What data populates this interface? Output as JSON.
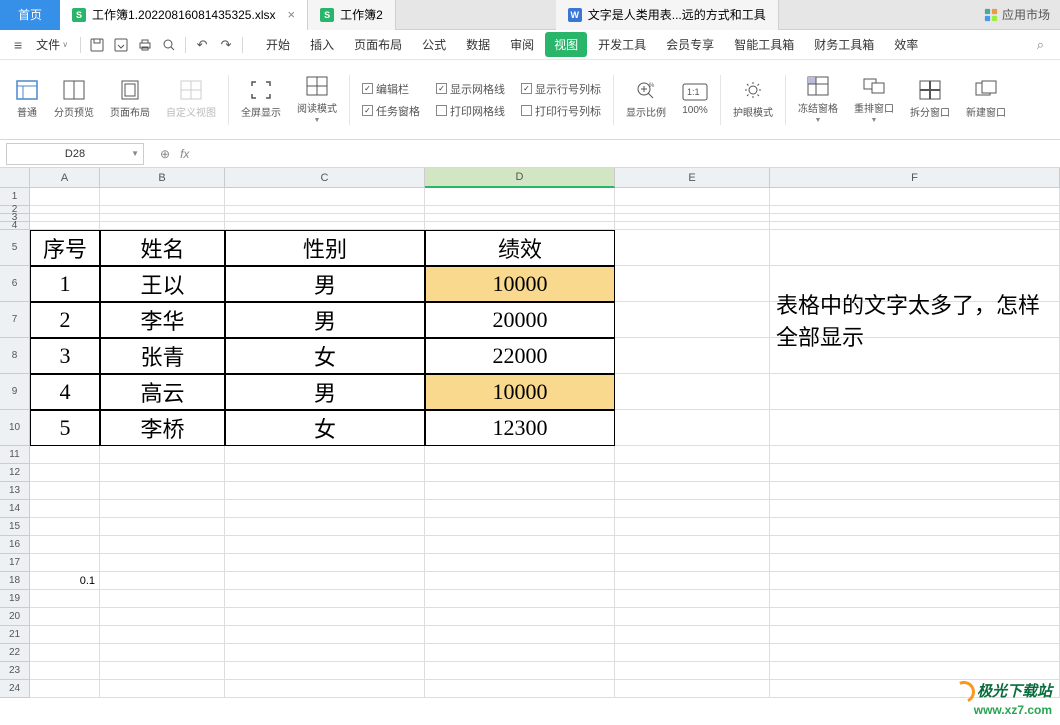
{
  "tabs": {
    "home": "首页",
    "file1": "工作簿1.20220816081435325.xlsx",
    "file2": "工作簿2",
    "file3": "文字是人类用表...远的方式和工具",
    "market": "应用市场"
  },
  "menu": {
    "file": "文件",
    "items": [
      "开始",
      "插入",
      "页面布局",
      "公式",
      "数据",
      "审阅",
      "视图",
      "开发工具",
      "会员专享",
      "智能工具箱",
      "财务工具箱",
      "效率"
    ]
  },
  "ribbon": {
    "normal": "普通",
    "pagebreak": "分页预览",
    "pagelayout": "页面布局",
    "custom": "自定义视图",
    "fullscreen": "全屏显示",
    "reading": "阅读模式",
    "editbar": "编辑栏",
    "taskpane": "任务窗格",
    "gridlines": "显示网格线",
    "printgrid": "打印网格线",
    "headings": "显示行号列标",
    "printhead": "打印行号列标",
    "zoom": "显示比例",
    "zoom100": "100%",
    "eyecare": "护眼模式",
    "freeze": "冻结窗格",
    "rearrange": "重排窗口",
    "split": "拆分窗口",
    "newwin": "新建窗口"
  },
  "namebox": "D28",
  "fx": "fx",
  "cols": {
    "A": 70,
    "B": 125,
    "C": 200,
    "D": 190,
    "E": 155,
    "F": 290
  },
  "headers": {
    "A": "序号",
    "B": "姓名",
    "C": "性别",
    "D": "绩效"
  },
  "rows": [
    {
      "A": "1",
      "B": "王以",
      "C": "男",
      "D": "10000",
      "hl": true
    },
    {
      "A": "2",
      "B": "李华",
      "C": "男",
      "D": "20000",
      "hl": false
    },
    {
      "A": "3",
      "B": "张青",
      "C": "女",
      "D": "22000",
      "hl": false
    },
    {
      "A": "4",
      "B": "高云",
      "C": "男",
      "D": "10000",
      "hl": true
    },
    {
      "A": "5",
      "B": "李桥",
      "C": "女",
      "D": "12300",
      "hl": false
    }
  ],
  "note": "表格中的文字太多了，怎样全部显示",
  "a18": "0.1",
  "watermark": {
    "l1": "极光下载站",
    "l2": "www.xz7.com"
  }
}
